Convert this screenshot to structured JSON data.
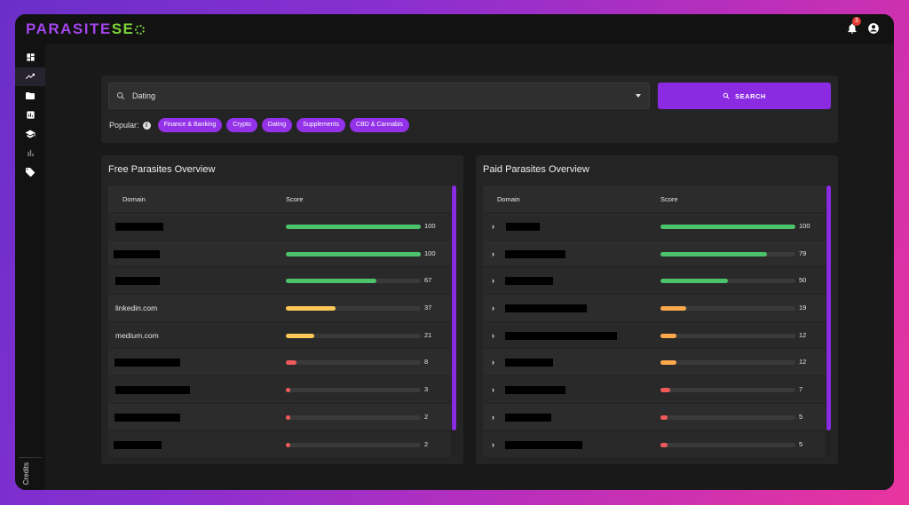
{
  "brand": {
    "part1": "PARASITE ",
    "part2": "SE"
  },
  "notifications": {
    "count": "3"
  },
  "sidebar": {
    "items": [
      "dashboard-icon",
      "trending-icon",
      "folder-icon",
      "analytics-icon",
      "school-icon",
      "bar-chart-icon",
      "tag-icon"
    ],
    "credits_label": "Credits"
  },
  "search": {
    "value": "Dating",
    "button_label": "SEARCH"
  },
  "popular": {
    "label": "Popular:",
    "chips": [
      "Finance & Banking",
      "Crypto",
      "Dating",
      "Supplements",
      "CBD & Cannabis"
    ]
  },
  "colors": {
    "accent": "#8a2be2",
    "high": "#4cc26a",
    "mid": "#ffc857",
    "low": "#ffa94d",
    "bad": "#ef5a5a"
  },
  "free_panel": {
    "title": "Free Parasites Overview",
    "col_domain": "Domain",
    "col_score": "Score",
    "rows": [
      {
        "domain": "",
        "score": "100",
        "pct": 100,
        "level": "high"
      },
      {
        "domain": "",
        "score": "100",
        "pct": 100,
        "level": "high"
      },
      {
        "domain": "",
        "score": "67",
        "pct": 67,
        "level": "high"
      },
      {
        "domain": "linkedin.com",
        "score": "37",
        "pct": 37,
        "level": "mid"
      },
      {
        "domain": "medium.com",
        "score": "21",
        "pct": 21,
        "level": "mid"
      },
      {
        "domain": "",
        "score": "8",
        "pct": 8,
        "level": "bad"
      },
      {
        "domain": "",
        "score": "3",
        "pct": 3,
        "level": "bad"
      },
      {
        "domain": "",
        "score": "2",
        "pct": 2,
        "level": "bad"
      },
      {
        "domain": "",
        "score": "2",
        "pct": 2,
        "level": "bad"
      }
    ]
  },
  "paid_panel": {
    "title": "Paid Parasites Overview",
    "col_domain": "Domain",
    "col_score": "Score",
    "rows": [
      {
        "domain": "",
        "score": "100",
        "pct": 100,
        "level": "high"
      },
      {
        "domain": "",
        "score": "79",
        "pct": 79,
        "level": "high"
      },
      {
        "domain": "",
        "score": "50",
        "pct": 50,
        "level": "high"
      },
      {
        "domain": "",
        "score": "19",
        "pct": 19,
        "level": "low"
      },
      {
        "domain": "",
        "score": "12",
        "pct": 12,
        "level": "low"
      },
      {
        "domain": "",
        "score": "12",
        "pct": 12,
        "level": "low"
      },
      {
        "domain": "",
        "score": "7",
        "pct": 7,
        "level": "bad"
      },
      {
        "domain": "",
        "score": "5",
        "pct": 5,
        "level": "bad"
      },
      {
        "domain": "",
        "score": "5",
        "pct": 5,
        "level": "bad"
      }
    ]
  }
}
